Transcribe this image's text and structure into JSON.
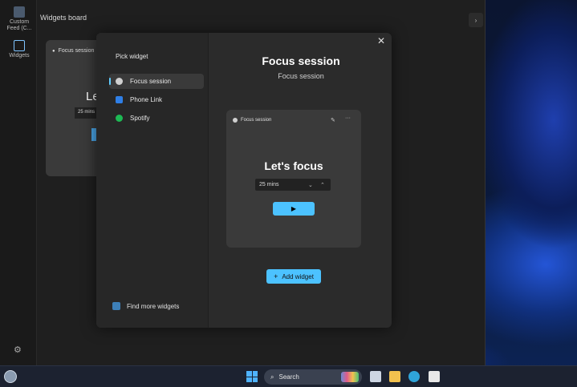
{
  "rail": {
    "custom_feed_label": "Custom Feed (C...",
    "widgets_label": "Widgets"
  },
  "board": {
    "title": "Widgets board",
    "bg_widget": {
      "header": "Focus session",
      "big_text": "Le",
      "mins": "25 mins"
    }
  },
  "dialog": {
    "pick_title": "Pick widget",
    "items": [
      {
        "label": "Focus session",
        "selected": true
      },
      {
        "label": "Phone Link",
        "selected": false
      },
      {
        "label": "Spotify",
        "selected": false
      }
    ],
    "find_more": "Find more widgets",
    "close_glyph": "✕",
    "title": "Focus session",
    "subtitle": "Focus session",
    "preview": {
      "header": "Focus session",
      "heading": "Let's focus",
      "mins": "25 mins",
      "play_glyph": "▶"
    },
    "add_label": "Add widget"
  },
  "taskbar": {
    "search_placeholder": "Search"
  },
  "colors": {
    "accent": "#4cc2ff",
    "spotify": "#1db954",
    "phone_link": "#2f7fe6"
  }
}
